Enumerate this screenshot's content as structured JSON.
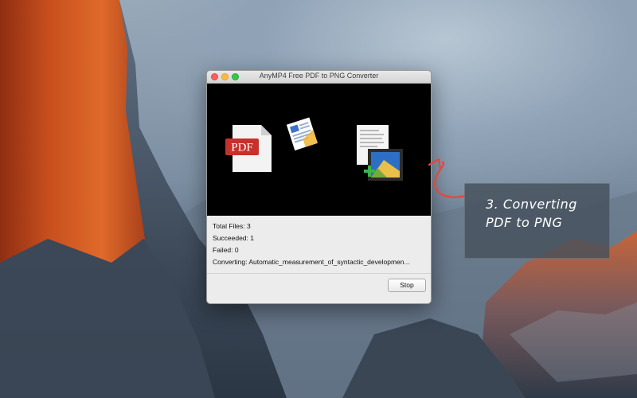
{
  "window": {
    "title": "AnyMP4 Free PDF to PNG Converter"
  },
  "stage": {
    "pdf_badge_text": "PDF"
  },
  "progress": {
    "total_files": "Total Files: 3",
    "succeeded": "Succeeded: 1",
    "failed": "Failed: 0",
    "converting": "Converting: Automatic_measurement_of_syntactic_developmen..."
  },
  "buttons": {
    "stop_label": "Stop"
  },
  "callout": {
    "line1": "3. Converting",
    "line2": "PDF to PNG"
  },
  "colors": {
    "arrow": "#e8453a",
    "pdf_red": "#c8302c",
    "close": "#fc605c",
    "minimize": "#fcbb40",
    "zoom": "#34c84a"
  }
}
